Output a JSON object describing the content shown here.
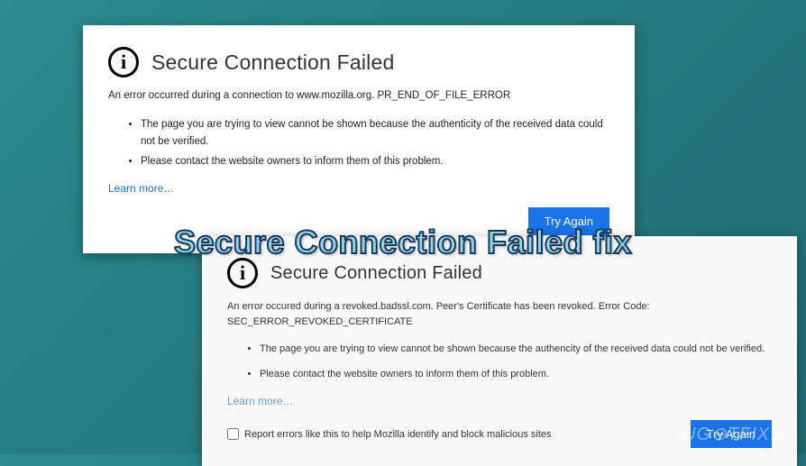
{
  "overlay_caption": "Secure Connection Failed fix",
  "watermark": "UG⊖TFIX",
  "watermark_suffix": ".com",
  "dialog1": {
    "title": "Secure Connection Failed",
    "error_line": "An error occurred during a connection to www.mozilla.org. PR_END_OF_FILE_ERROR",
    "bullets": [
      "The page you are trying to view cannot be shown because the authenticity of the received data could not be verified.",
      "Please contact the website owners to inform them of this problem."
    ],
    "learn_more": "Learn more…",
    "try_again": "Try Again"
  },
  "dialog2": {
    "title": "Secure Connection Failed",
    "error_line": "An error occured during a revoked.badssl.com. Peer's Certificate has been revoked.  Error Code:",
    "error_code": "SEC_ERROR_REVOKED_CERTIFICATE",
    "bullets": [
      "The page you are trying to view cannot be shown because the authencity of the received data could not be verified.",
      "Please contact the website owners to inform them of this problem."
    ],
    "learn_more": "Learn more…",
    "report_label": "Report errors like this to help Mozilla identify and block malicious sites",
    "try_again": "Try Again"
  }
}
